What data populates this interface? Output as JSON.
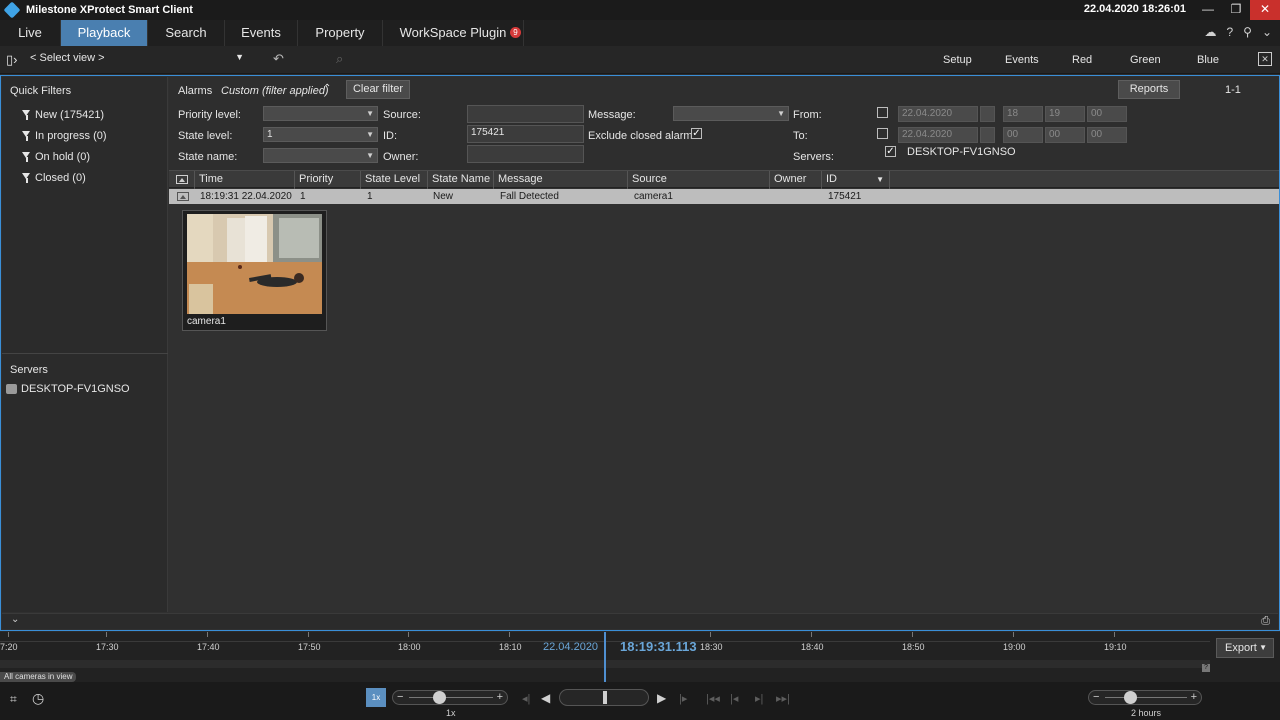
{
  "window": {
    "title": "Milestone XProtect Smart Client",
    "clock": "22.04.2020 18:26:01",
    "controls": {
      "minimize": "—",
      "restore": "❐",
      "close": "✕"
    }
  },
  "tabs": [
    {
      "label": "Live"
    },
    {
      "label": "Playback",
      "active": true
    },
    {
      "label": "Search"
    },
    {
      "label": "Events"
    },
    {
      "label": "Property"
    },
    {
      "label": "WorkSpace Plugin",
      "badge": "9"
    }
  ],
  "toolbar": {
    "select_view": "< Select view >",
    "right_items": [
      "Setup",
      "Events",
      "Red",
      "Green",
      "Blue"
    ]
  },
  "quick_filters": {
    "title": "Quick Filters",
    "items": [
      "New (175421)",
      "In progress (0)",
      "On hold (0)",
      "Closed (0)"
    ]
  },
  "servers_panel": {
    "title": "Servers",
    "items": [
      "DESKTOP-FV1GNSO"
    ]
  },
  "alarms": {
    "label": "Alarms",
    "filter_status": "Custom (filter applied)",
    "clear_filter": "Clear filter",
    "reports": "Reports",
    "page": "1-1",
    "fields": {
      "priority_level_label": "Priority level:",
      "state_level_label": "State level:",
      "state_level_value": "1",
      "state_name_label": "State name:",
      "source_label": "Source:",
      "id_label": "ID:",
      "id_value": "175421",
      "owner_label": "Owner:",
      "message_label": "Message:",
      "exclude_closed_label": "Exclude closed alarms",
      "from_label": "From:",
      "to_label": "To:",
      "servers_label": "Servers:",
      "server_value": "DESKTOP-FV1GNSO",
      "from_date": "22.04.2020",
      "from_hour": "18",
      "from_min": "19",
      "from_sec": "00",
      "to_date": "22.04.2020",
      "to_hour": "00",
      "to_min": "00",
      "to_sec": "00"
    }
  },
  "table": {
    "columns": [
      "Time",
      "Priority Level",
      "State Level",
      "State Name",
      "Message",
      "Source",
      "Owner",
      "ID"
    ],
    "rows": [
      {
        "time": "18:19:31 22.04.2020",
        "priority": "1",
        "state_level": "1",
        "state_name": "New",
        "message": "Fall Detected",
        "source": "camera1",
        "owner": "",
        "id": "175421"
      }
    ]
  },
  "thumbnail": {
    "caption": "camera1"
  },
  "timeline": {
    "ticks": [
      "7:20",
      "17:30",
      "17:40",
      "17:50",
      "18:00",
      "18:10",
      "18:30",
      "18:40",
      "18:50",
      "19:00",
      "19:10"
    ],
    "date": "22.04.2020",
    "time": "18:19:31.113",
    "all_cameras": "All cameras in view",
    "export": "Export",
    "help": "?"
  },
  "playback": {
    "speed_box": "1x",
    "speed_label": "1x",
    "span_label": "2 hours"
  },
  "colors": {
    "accent": "#4a7fb0",
    "frame_border": "#3a8fd8",
    "timeline_text": "#6aa6d8",
    "badge": "#d63a3a"
  }
}
